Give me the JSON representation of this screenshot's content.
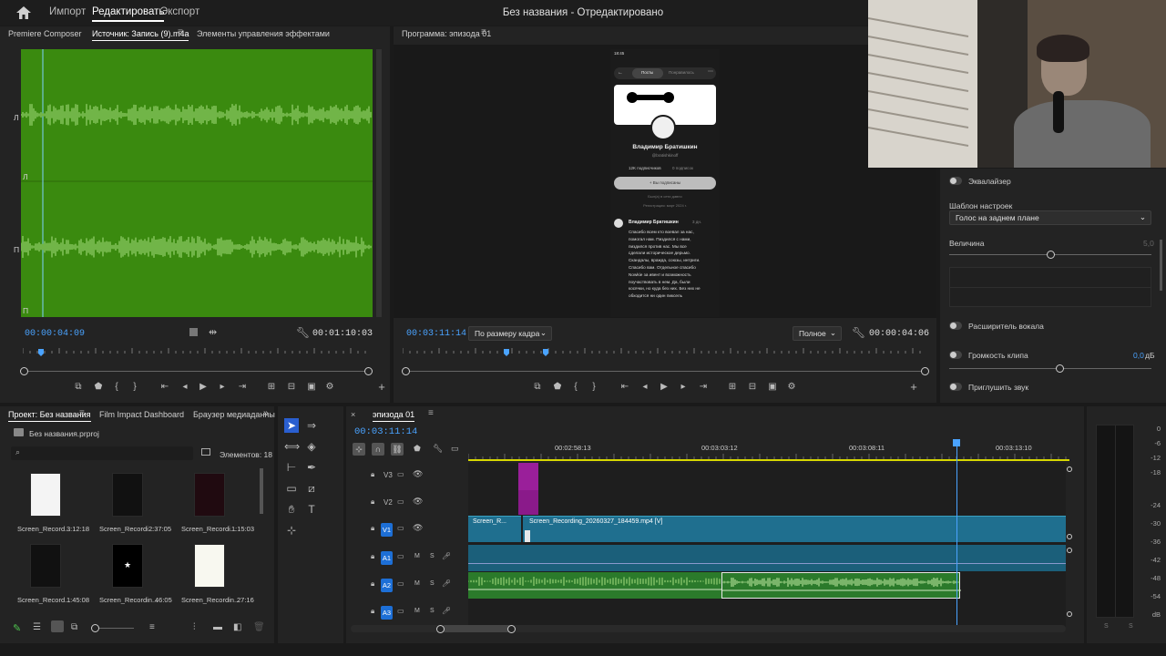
{
  "topbar": {
    "menu": [
      "Импорт",
      "Редактировать",
      "Экспорт"
    ],
    "title": "Без названия - Отредактировано"
  },
  "source": {
    "tabs": [
      "Premiere Composer",
      "Источник: Запись (9).m4a",
      "Элементы управления эффектами"
    ],
    "channel_labels": [
      "Л",
      "Л",
      "П",
      "П"
    ],
    "timecode_in": "00:00:04:09",
    "timecode_out": "00:01:10:03",
    "playhead_fraction": 0.06
  },
  "program": {
    "tab": "Программа: эпизода 01",
    "timecode_in": "00:03:11:14",
    "fit": "По размеру кадра",
    "quality": "Полное",
    "timecode_out": "00:00:04:06",
    "phone": {
      "status_time": "18:45",
      "tabs": [
        "Посты",
        "Понравилось"
      ],
      "name": "Владимир Братишкин",
      "handle": "@bratishkinoff",
      "followers": "12K подписчиков",
      "following": "0 подписок",
      "follow_btn": "+ Вы подписаны",
      "meta1": "Был(а) в сети давно",
      "meta2": "Регистрация: март 2024 г.",
      "post_author": "Владимир Братишкин",
      "post_time": "3 дн.",
      "post_text": "Спасибо всем кто воевал за нас, помогал нам. Пиздился с нами, пиздился против нас. Мы все сделали историческое дерьмо. Скандалы, вражда, союзы, интриги. Спасибо вам. Отдельное спасибо Nowkie за ивент и возможность поучаствовать в нем. Да, были косячки, но куда без них. Без них не обходится ни один пиксель"
    }
  },
  "effects": {
    "eq_label": "Эквалайзер",
    "preset_label": "Шаблон настроек",
    "preset_value": "Голос на заднем плане",
    "amount_label": "Величина",
    "amount_value": "5,0",
    "amount_fraction": 0.5,
    "vocal_label": "Расширитель вокала",
    "gain_label": "Громкость клипа",
    "gain_value": "0,0",
    "gain_unit": "дБ",
    "mute_label": "Приглушить звук"
  },
  "project": {
    "tabs": [
      "Проект: Без названия",
      "Film Impact Dashboard",
      "Браузер медиаданны"
    ],
    "file": "Без названия.prproj",
    "items_count": "Элементов: 18",
    "items": [
      {
        "name": "Screen_Record...",
        "dur": "3:12:18"
      },
      {
        "name": "Screen_Recordi...",
        "dur": "2:37:05"
      },
      {
        "name": "Screen_Recordi...",
        "dur": "1:15:03"
      },
      {
        "name": "Screen_Record...",
        "dur": "1:45:08"
      },
      {
        "name": "Screen_Recordin...",
        "dur": "46:05"
      },
      {
        "name": "Screen_Recordin...",
        "dur": "27:16"
      }
    ]
  },
  "timeline": {
    "tab": "эпизода 01",
    "timecode": "00:03:11:14",
    "ruler": [
      "00:02:58:13",
      "00:03:03:12",
      "00:03:08:11",
      "00:03:13:10"
    ],
    "tracks": [
      "V3",
      "V2",
      "V1",
      "A1",
      "A2",
      "A3"
    ],
    "clip_v1a": "Screen_R...",
    "clip_v1b": "Screen_Recording_20260327_184459.mp4 [V]",
    "m": "M",
    "s": "S"
  },
  "meter": {
    "scale": [
      "0",
      "-6",
      "-12",
      "-18",
      "-24",
      "-30",
      "-36",
      "-42",
      "-48",
      "-54",
      "dB"
    ],
    "bottom": [
      "S",
      "S"
    ]
  },
  "colors": {
    "accent": "#4aa3ff",
    "waveform": "#3a8a0f",
    "track_blue": "#1d6fd6"
  }
}
